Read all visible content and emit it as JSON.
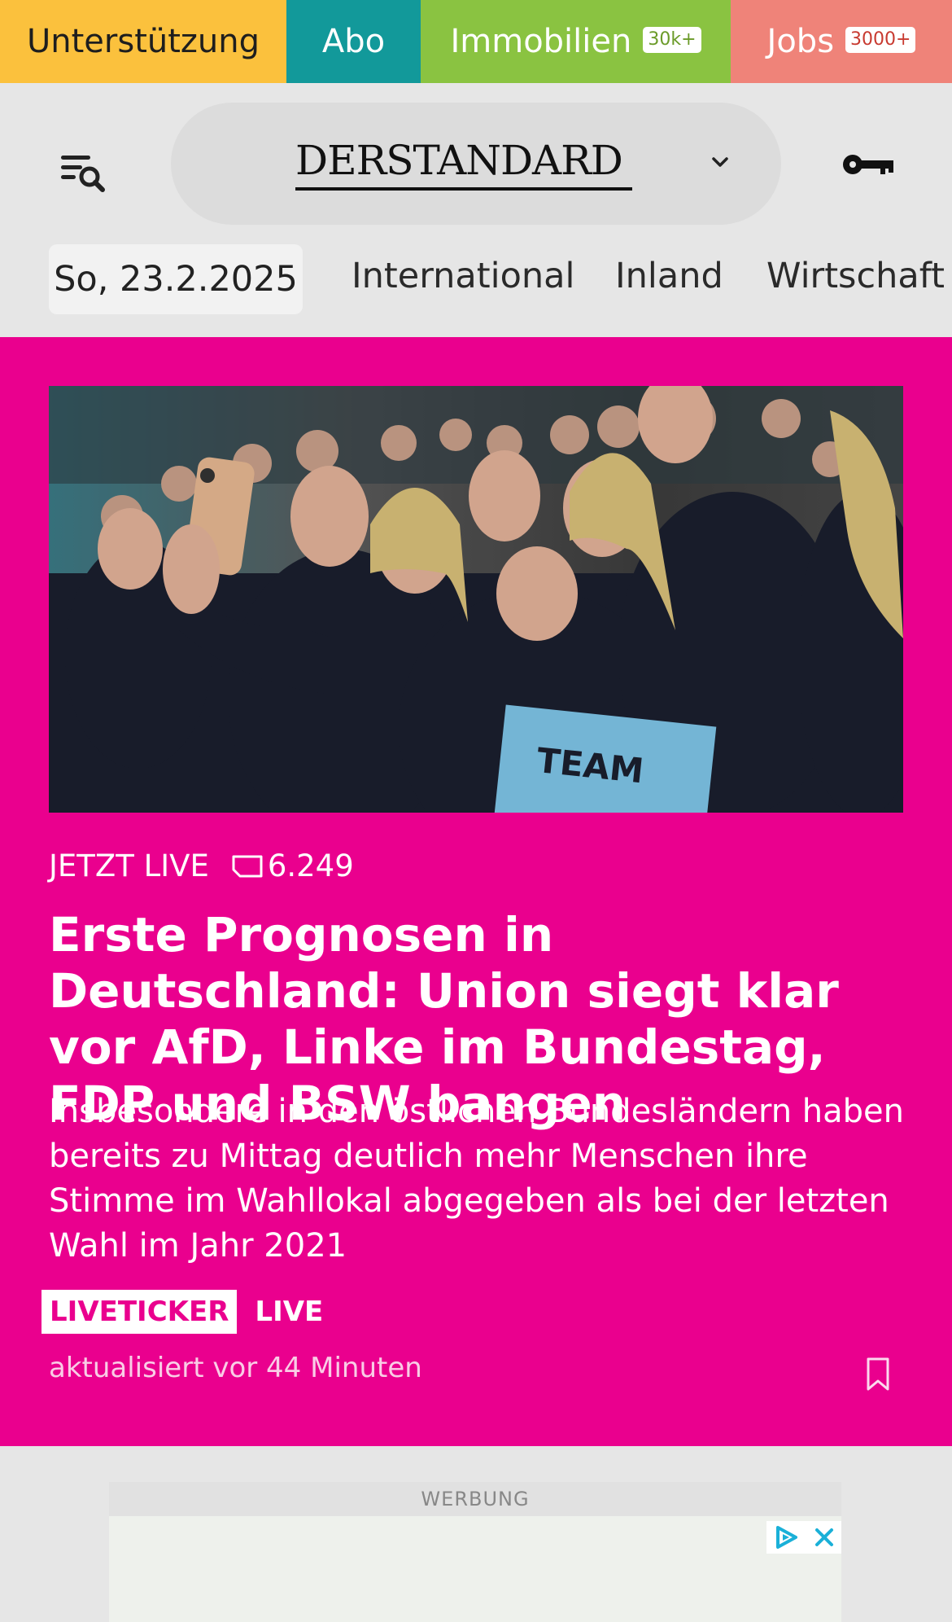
{
  "topbar": {
    "support_label": "Unterstützung",
    "abo_label": "Abo",
    "immobilien_label": "Immobilien",
    "immobilien_badge": "30k+",
    "jobs_label": "Jobs",
    "jobs_badge": "3000+"
  },
  "header": {
    "logo_text": "DERSTANDARD"
  },
  "nav": {
    "date": "So, 23.2.2025",
    "items": [
      "International",
      "Inland",
      "Wirtschaft"
    ]
  },
  "hero": {
    "status": "JETZT LIVE",
    "comment_count": "6.249",
    "headline": "Erste Prognosen in Deutschland: Union siegt klar vor AfD, Linke im Bundestag, FDP und BSW bangen",
    "teaser": "Insbesondere in den östlichen Bundesländern haben bereits zu Mittag deutlich mehr Menschen ihre Stimme im Wahllokal abgegeben als bei der letzten Wahl im Jahr 2021",
    "tag_liveticker": "LIVETICKER",
    "tag_live": "LIVE",
    "updated": "aktualisiert vor 44 Minuten",
    "image_sign_text": "TEAM"
  },
  "ad": {
    "label": "WERBUNG"
  },
  "colors": {
    "hero_bg": "#ea008e",
    "support": "#fbc13d",
    "abo": "#12999a",
    "immobilien": "#8ac341",
    "jobs": "#ef8379"
  }
}
